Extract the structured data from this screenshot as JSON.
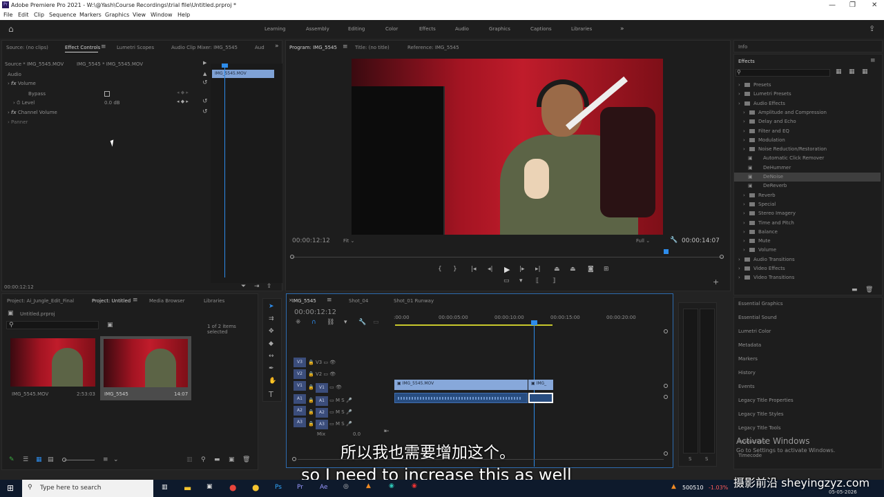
{
  "window": {
    "title": "Adobe Premiere Pro 2021 - W:\\@Yash\\Course Recordings\\trial file\\Untitled.prproj *"
  },
  "menu": [
    "File",
    "Edit",
    "Clip",
    "Sequence",
    "Markers",
    "Graphics",
    "View",
    "Window",
    "Help"
  ],
  "workspaces": [
    "Learning",
    "Assembly",
    "Editing",
    "Color",
    "Effects",
    "Audio",
    "Graphics",
    "Captions",
    "Libraries"
  ],
  "source_panel": {
    "tabs": [
      "Source: (no clips)",
      "Effect Controls",
      "Lumetri Scopes",
      "Audio Clip Mixer: IMG_5545",
      "Aud"
    ],
    "source_path": "Source * IMG_5545.MOV",
    "clip_path": "IMG_5545 * IMG_5545.MOV",
    "clip_bar": "IMG_5545.MOV",
    "section": "Audio",
    "volume": "Volume",
    "bypass": "Bypass",
    "level": "Level",
    "level_value": "0.0 dB",
    "channel_volume": "Channel Volume",
    "panner": "Panner",
    "timecode": "00:00:12:12"
  },
  "program": {
    "tab": "Program: IMG_5545",
    "title_tab": "Title: (no title)",
    "ref_tab": "Reference: IMG_5545",
    "timecode_left": "00:00:12:12",
    "fit": "Fit",
    "full": "Full",
    "timecode_right": "00:00:14:07"
  },
  "info": {
    "label": "Info"
  },
  "effects": {
    "title": "Effects",
    "items": [
      {
        "label": "Presets",
        "level": 0
      },
      {
        "label": "Lumetri Presets",
        "level": 0
      },
      {
        "label": "Audio Effects",
        "level": 0
      },
      {
        "label": "Amplitude and Compression",
        "level": 1
      },
      {
        "label": "Delay and Echo",
        "level": 1
      },
      {
        "label": "Filter and EQ",
        "level": 1
      },
      {
        "label": "Modulation",
        "level": 1
      },
      {
        "label": "Noise Reduction/Restoration",
        "level": 1
      },
      {
        "label": "Automatic Click Remover",
        "level": 2
      },
      {
        "label": "DeHummer",
        "level": 2
      },
      {
        "label": "DeNoise",
        "level": 2
      },
      {
        "label": "DeReverb",
        "level": 2
      },
      {
        "label": "Reverb",
        "level": 1
      },
      {
        "label": "Special",
        "level": 1
      },
      {
        "label": "Stereo Imagery",
        "level": 1
      },
      {
        "label": "Time and Pitch",
        "level": 1
      },
      {
        "label": "Balance",
        "level": 1
      },
      {
        "label": "Mute",
        "level": 1
      },
      {
        "label": "Volume",
        "level": 1
      },
      {
        "label": "Audio Transitions",
        "level": 0
      },
      {
        "label": "Video Effects",
        "level": 0
      },
      {
        "label": "Video Transitions",
        "level": 0
      }
    ],
    "selected": "DeNoise"
  },
  "side_panels": [
    "Essential Graphics",
    "Essential Sound",
    "Lumetri Color",
    "Metadata",
    "Markers",
    "History",
    "Events",
    "Legacy Title Properties",
    "Legacy Title Styles",
    "Legacy Title Tools",
    "Productions",
    "Timecode"
  ],
  "project": {
    "tabs": [
      "Project: Ai_Jungle_Edit_Final",
      "Project: Untitled",
      "Media Browser",
      "Libraries"
    ],
    "file": "Untitled.prproj",
    "count": "1 of 2 items selected",
    "items": [
      {
        "name": "IMG_5545.MOV",
        "duration": "2:53:03"
      },
      {
        "name": "IMG_5545",
        "duration": "14:07"
      }
    ]
  },
  "timeline": {
    "tabs": [
      "IMG_5545",
      "Shot_04",
      "Shot_01 Runway"
    ],
    "timecode": "00:00:12:12",
    "ruler": [
      ":00:00",
      "00:00:05:00",
      "00:00:10:00",
      "00:00:15:00",
      "00:00:20:00"
    ],
    "video_tracks": [
      "V3",
      "V2",
      "V1"
    ],
    "audio_tracks": [
      "A1",
      "A2",
      "A3"
    ],
    "mix": "Mix",
    "mix_value": "0.0",
    "clip": "IMG_5545.MOV",
    "clip2": "IMG_"
  },
  "subtitles": {
    "cn": "所以我也需要增加这个。",
    "en": "so I need to increase this as well"
  },
  "watermark": {
    "activate": "Activate Windows",
    "activate_sub": "Go to Settings to activate Windows.",
    "site": "摄影前沿 sheyingzyz.com"
  },
  "taskbar": {
    "search": "Type here to search",
    "stock": "500510",
    "stock_change": "-1.03%",
    "date": "05-05-2026"
  }
}
